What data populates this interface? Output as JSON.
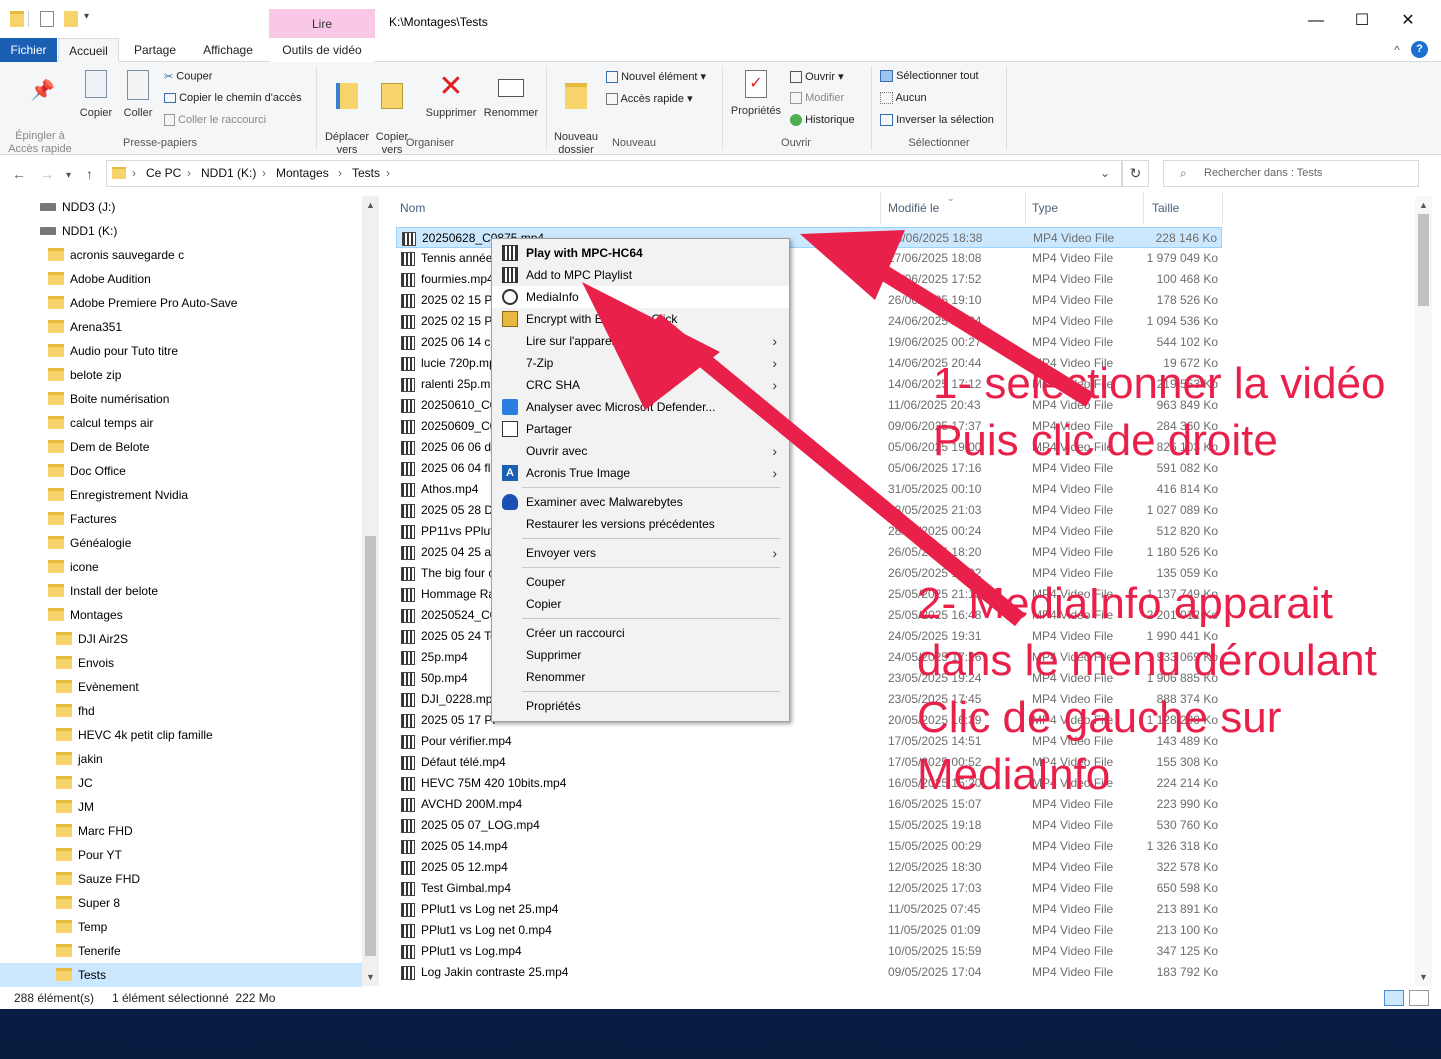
{
  "window": {
    "title": "K:\\Montages\\Tests",
    "contextual_tab": "Lire",
    "minimize": "—",
    "maximize": "☐",
    "close": "✕"
  },
  "tabs": [
    "Fichier",
    "Accueil",
    "Partage",
    "Affichage",
    "Outils de vidéo"
  ],
  "ribbon": {
    "clipboard": {
      "pin": "Épingler à\nAccès rapide",
      "copy": "Copier",
      "paste": "Coller",
      "cut": "Couper",
      "copy_path": "Copier le chemin d'accès",
      "paste_shortcut": "Coller le raccourci",
      "label": "Presse-papiers"
    },
    "organize": {
      "move": "Déplacer\nvers",
      "copyto": "Copier\nvers",
      "delete": "Supprimer",
      "rename": "Renommer",
      "label": "Organiser"
    },
    "new": {
      "new_folder": "Nouveau\ndossier",
      "new_item": "Nouvel élément",
      "easy_access": "Accès rapide",
      "label": "Nouveau"
    },
    "open": {
      "properties": "Propriétés",
      "open": "Ouvrir",
      "edit": "Modifier",
      "history": "Historique",
      "label": "Ouvrir"
    },
    "select": {
      "all": "Sélectionner tout",
      "none": "Aucun",
      "invert": "Inverser la sélection",
      "label": "Sélectionner"
    }
  },
  "address": {
    "crumbs": [
      "Ce PC",
      "NDD1 (K:)",
      "Montages",
      "Tests"
    ],
    "search_placeholder": "Rechercher dans : Tests"
  },
  "nav": [
    {
      "label": "NDD3 (J:)",
      "type": "drive",
      "indent": 0
    },
    {
      "label": "NDD1 (K:)",
      "type": "drive",
      "indent": 0
    },
    {
      "label": "acronis sauvegarde c",
      "type": "folder",
      "indent": 1
    },
    {
      "label": "Adobe Audition",
      "type": "folder",
      "indent": 1
    },
    {
      "label": "Adobe Premiere Pro Auto-Save",
      "type": "folder",
      "indent": 1
    },
    {
      "label": "Arena351",
      "type": "folder",
      "indent": 1
    },
    {
      "label": "Audio pour Tuto titre",
      "type": "folder",
      "indent": 1
    },
    {
      "label": "belote zip",
      "type": "folder",
      "indent": 1
    },
    {
      "label": "Boite numérisation",
      "type": "folder",
      "indent": 1
    },
    {
      "label": "calcul temps air",
      "type": "folder",
      "indent": 1
    },
    {
      "label": "Dem de Belote",
      "type": "folder",
      "indent": 1
    },
    {
      "label": "Doc Office",
      "type": "folder",
      "indent": 1
    },
    {
      "label": "Enregistrement Nvidia",
      "type": "folder",
      "indent": 1
    },
    {
      "label": "Factures",
      "type": "folder",
      "indent": 1
    },
    {
      "label": "Généalogie",
      "type": "folder",
      "indent": 1
    },
    {
      "label": "icone",
      "type": "folder",
      "indent": 1
    },
    {
      "label": "Install der belote",
      "type": "folder",
      "indent": 1
    },
    {
      "label": "Montages",
      "type": "folder",
      "indent": 1
    },
    {
      "label": "DJI Air2S",
      "type": "folder",
      "indent": 2
    },
    {
      "label": "Envois",
      "type": "folder",
      "indent": 2
    },
    {
      "label": "Evènement",
      "type": "folder",
      "indent": 2
    },
    {
      "label": "fhd",
      "type": "folder",
      "indent": 2
    },
    {
      "label": "HEVC 4k petit clip famille",
      "type": "folder",
      "indent": 2
    },
    {
      "label": "jakin",
      "type": "folder",
      "indent": 2
    },
    {
      "label": "JC",
      "type": "folder",
      "indent": 2
    },
    {
      "label": "JM",
      "type": "folder",
      "indent": 2
    },
    {
      "label": "Marc FHD",
      "type": "folder",
      "indent": 2
    },
    {
      "label": "Pour YT",
      "type": "folder",
      "indent": 2
    },
    {
      "label": "Sauze FHD",
      "type": "folder",
      "indent": 2
    },
    {
      "label": "Super 8",
      "type": "folder",
      "indent": 2
    },
    {
      "label": "Temp",
      "type": "folder",
      "indent": 2
    },
    {
      "label": "Tenerife",
      "type": "folder",
      "indent": 2
    },
    {
      "label": "Tests",
      "type": "folder",
      "indent": 2,
      "selected": true
    }
  ],
  "columns": {
    "name": "Nom",
    "modified": "Modifié le",
    "type": "Type",
    "size": "Taille"
  },
  "files": [
    {
      "name": "20250628_C0875.mp4",
      "date": "28/06/2025 18:38",
      "type": "MP4 Video File",
      "size": "228 146 Ko",
      "selected": true
    },
    {
      "name": "Tennis année",
      "date": "27/06/2025 18:08",
      "type": "MP4 Video File",
      "size": "1 979 049 Ko"
    },
    {
      "name": "fourmies.mp4",
      "date": "26/06/2025 17:52",
      "type": "MP4 Video File",
      "size": "100 468 Ko"
    },
    {
      "name": "2025 02 15 Po",
      "date": "26/06/2025 19:10",
      "type": "MP4 Video File",
      "size": "178 526 Ko"
    },
    {
      "name": "2025 02 15 Po",
      "date": "24/06/2025 18:34",
      "type": "MP4 Video File",
      "size": "1 094 536 Ko"
    },
    {
      "name": "2025 06 14 ch",
      "date": "19/06/2025 00:27",
      "type": "MP4 Video File",
      "size": "544 102 Ko"
    },
    {
      "name": "lucie 720p.mp",
      "date": "14/06/2025 20:44",
      "type": "MP4 Video File",
      "size": "19 672 Ko"
    },
    {
      "name": "ralenti 25p.m",
      "date": "14/06/2025 17:12",
      "type": "MP4 Video File",
      "size": "219 553 Ko"
    },
    {
      "name": "20250610_C0",
      "date": "11/06/2025 20:43",
      "type": "MP4 Video File",
      "size": "963 849 Ko"
    },
    {
      "name": "20250609_C0",
      "date": "09/06/2025 17:37",
      "type": "MP4 Video File",
      "size": "284 360 Ko"
    },
    {
      "name": "2025 06 06 dr",
      "date": "05/06/2025 19:00",
      "type": "MP4 Video File",
      "size": "826 103 Ko"
    },
    {
      "name": "2025 06 04 fle",
      "date": "05/06/2025 17:16",
      "type": "MP4 Video File",
      "size": "591 082 Ko"
    },
    {
      "name": "Athos.mp4",
      "date": "31/05/2025 00:10",
      "type": "MP4 Video File",
      "size": "416 814 Ko"
    },
    {
      "name": "2025 05 28 DJ",
      "date": "28/05/2025 21:03",
      "type": "MP4 Video File",
      "size": "1 027 089 Ko"
    },
    {
      "name": "PP11vs PPlut",
      "date": "28/05/2025 00:24",
      "type": "MP4 Video File",
      "size": "512 820 Ko"
    },
    {
      "name": "2025 04 25 an",
      "date": "26/05/2025 18:20",
      "type": "MP4 Video File",
      "size": "1 180 526 Ko"
    },
    {
      "name": "The big four c",
      "date": "26/05/2025 16:02",
      "type": "MP4 Video File",
      "size": "135 059 Ko"
    },
    {
      "name": "Hommage Ra",
      "date": "25/05/2025 21:13",
      "type": "MP4 Video File",
      "size": "1 137 749 Ko"
    },
    {
      "name": "20250524_C0",
      "date": "25/05/2025 16:48",
      "type": "MP4 Video File",
      "size": "2 201 012 Ko"
    },
    {
      "name": "2025 05 24 To",
      "date": "24/05/2025 19:31",
      "type": "MP4 Video File",
      "size": "1 990 441 Ko"
    },
    {
      "name": "25p.mp4",
      "date": "24/05/2025 17:26",
      "type": "MP4 Video File",
      "size": "1 933 069 Ko"
    },
    {
      "name": "50p.mp4",
      "date": "23/05/2025 19:24",
      "type": "MP4 Video File",
      "size": "1 906 885 Ko"
    },
    {
      "name": "DJI_0228.mp4",
      "date": "23/05/2025 17:45",
      "type": "MP4 Video File",
      "size": "888 374 Ko"
    },
    {
      "name": "2025 05 17 PP",
      "date": "20/05/2025 16:39",
      "type": "MP4 Video File",
      "size": "1 128 290 Ko"
    },
    {
      "name": "Pour vérifier.mp4",
      "date": "17/05/2025 14:51",
      "type": "MP4 Video File",
      "size": "143 489 Ko"
    },
    {
      "name": "Défaut télé.mp4",
      "date": "17/05/2025 00:52",
      "type": "MP4 Video File",
      "size": "155 308 Ko"
    },
    {
      "name": "HEVC 75M 420 10bits.mp4",
      "date": "16/05/2025 15:20",
      "type": "MP4 Video File",
      "size": "224 214 Ko"
    },
    {
      "name": "AVCHD 200M.mp4",
      "date": "16/05/2025 15:07",
      "type": "MP4 Video File",
      "size": "223 990 Ko"
    },
    {
      "name": "2025 05 07_LOG.mp4",
      "date": "15/05/2025 19:18",
      "type": "MP4 Video File",
      "size": "530 760 Ko"
    },
    {
      "name": "2025 05 14.mp4",
      "date": "15/05/2025 00:29",
      "type": "MP4 Video File",
      "size": "1 326 318 Ko"
    },
    {
      "name": "2025 05 12.mp4",
      "date": "12/05/2025 18:30",
      "type": "MP4 Video File",
      "size": "322 578 Ko"
    },
    {
      "name": "Test Gimbal.mp4",
      "date": "12/05/2025 17:03",
      "type": "MP4 Video File",
      "size": "650 598 Ko"
    },
    {
      "name": "PPlut1 vs Log net 25.mp4",
      "date": "11/05/2025 07:45",
      "type": "MP4 Video File",
      "size": "213 891 Ko"
    },
    {
      "name": "PPlut1 vs Log net 0.mp4",
      "date": "11/05/2025 01:09",
      "type": "MP4 Video File",
      "size": "213 100 Ko"
    },
    {
      "name": "PPlut1 vs Log.mp4",
      "date": "10/05/2025 15:59",
      "type": "MP4 Video File",
      "size": "347 125 Ko"
    },
    {
      "name": "Log Jakin contraste 25.mp4",
      "date": "09/05/2025 17:04",
      "type": "MP4 Video File",
      "size": "183 792 Ko"
    }
  ],
  "status": {
    "count": "288 élément(s)",
    "selection": "1 élément sélectionné  222 Mo"
  },
  "context_menu": [
    {
      "label": "Play with MPC-HC64",
      "bold": true,
      "icon": "mpc-icon"
    },
    {
      "label": "Add to MPC Playlist",
      "icon": "mpc-icon"
    },
    {
      "label": "MediaInfo",
      "icon": "mediainfo-icon",
      "highlight": true
    },
    {
      "label": "Encrypt with EncryptOnClick",
      "icon": "lock-icon"
    },
    {
      "label": "Lire sur l'appareil",
      "arrow": true
    },
    {
      "label": "7-Zip",
      "arrow": true
    },
    {
      "label": "CRC SHA",
      "arrow": true
    },
    {
      "label": "Analyser avec Microsoft Defender...",
      "icon": "defender-icon"
    },
    {
      "label": "Partager",
      "icon": "share-icon"
    },
    {
      "label": "Ouvrir avec",
      "arrow": true
    },
    {
      "label": "Acronis True Image",
      "icon": "acronis-icon",
      "arrow": true
    },
    {
      "sep": true
    },
    {
      "label": "Examiner avec Malwarebytes",
      "icon": "malwarebytes-icon"
    },
    {
      "label": "Restaurer les versions précédentes"
    },
    {
      "sep": true
    },
    {
      "label": "Envoyer vers",
      "arrow": true
    },
    {
      "sep": true
    },
    {
      "label": "Couper"
    },
    {
      "label": "Copier"
    },
    {
      "sep": true
    },
    {
      "label": "Créer un raccourci"
    },
    {
      "label": "Supprimer"
    },
    {
      "label": "Renommer"
    },
    {
      "sep": true
    },
    {
      "label": "Propriétés"
    }
  ],
  "annotations": {
    "step1_line1": "1- selectionner la vidéo",
    "step1_line2": "Puis clic de droite",
    "step2_line1": "2- MediaInfo apparait",
    "step2_line2": "dans le menu déroulant",
    "step2_line3": "Clic de gauche sur",
    "step2_line4": "MediaInfo",
    "color": "#e8204a"
  },
  "colors": {
    "accent": "#1a5fb4",
    "selection": "#cce8ff",
    "contextual_tab": "#f9c8e6"
  }
}
